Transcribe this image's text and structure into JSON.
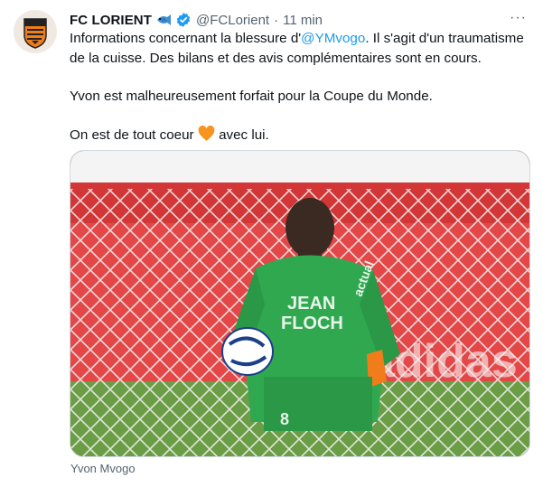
{
  "tweet": {
    "display_name": "FC LORIENT",
    "handle": "@FCLorient",
    "separator": "·",
    "time": "11 min",
    "more_label": "···",
    "text": {
      "line1_pre": "Informations concernant la blessure d'",
      "mention": "@YMvogo",
      "line1_post": ". Il s'agit d'un traumatisme de la cuisse. Des bilans et des avis complémentaires sont en cours.",
      "para2": "Yvon est malheureusement forfait pour la Coupe du Monde.",
      "para3_pre": "On est de tout coeur ",
      "para3_post": " avec lui."
    },
    "media_caption": "Yvon Mvogo",
    "jersey": {
      "sponsor_line1": "JEAN",
      "sponsor_line2": "FLOCH",
      "sleeve_text": "actual",
      "shorts_number": "8"
    },
    "colors": {
      "accent": "#1d9bf0",
      "brand_orange": "#f07d19",
      "jersey_green": "#2fa84f",
      "heart": "#f7931e"
    },
    "icons": {
      "emoji": "fish-icon",
      "verified": "verified-badge-icon",
      "heart": "orange-heart-icon"
    }
  }
}
